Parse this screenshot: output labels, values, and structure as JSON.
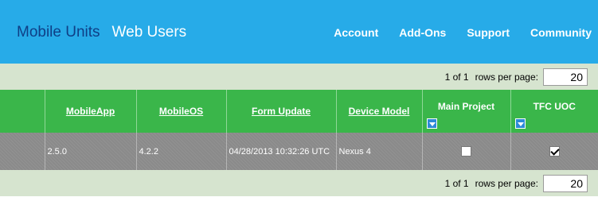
{
  "nav": {
    "tabs": [
      {
        "label": "Mobile Units",
        "active": true
      },
      {
        "label": "Web Users",
        "active": false
      }
    ],
    "links": [
      "Account",
      "Add-Ons",
      "Support",
      "Community"
    ]
  },
  "pager_top": {
    "page_info": "1  of 1",
    "rows_label": "rows per page:",
    "rows_value": "20"
  },
  "pager_bottom": {
    "page_info": "1  of 1",
    "rows_label": "rows per page:",
    "rows_value": "20"
  },
  "table": {
    "columns": [
      {
        "label": "",
        "sortable": false
      },
      {
        "label": "MobileApp",
        "sortable": true
      },
      {
        "label": "MobileOS",
        "sortable": true
      },
      {
        "label": "Form Update",
        "sortable": true
      },
      {
        "label": "Device Model",
        "sortable": true
      },
      {
        "label": "Main Project",
        "sortable": false,
        "filter": true
      },
      {
        "label": "TFC UOC",
        "sortable": false,
        "filter": true
      }
    ],
    "rows": [
      {
        "blank": "",
        "mobile_app": "2.5.0",
        "mobile_os": "4.2.2",
        "form_update": "04/28/2013 10:32:26 UTC",
        "device_model": "Nexus 4",
        "main_project": false,
        "tfc_uoc": true
      }
    ]
  },
  "colors": {
    "header_bar": "#27abe8",
    "active_tab": "#0f3f86",
    "table_header": "#3ab64a",
    "pager_bg": "#d6e4cf",
    "row_bg": "#8a8a8a"
  }
}
